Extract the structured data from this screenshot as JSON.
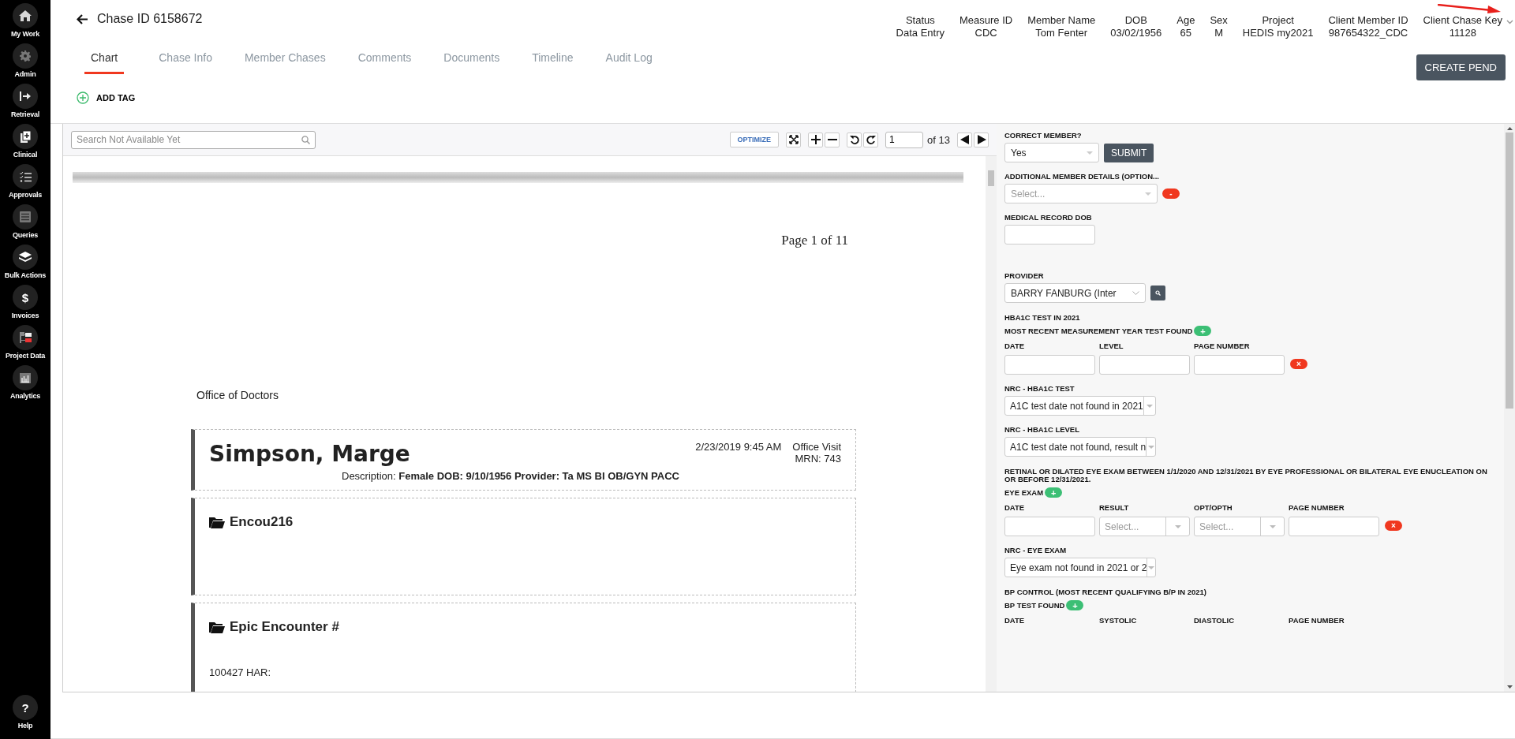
{
  "sidebar": {
    "items": [
      {
        "label": "My Work"
      },
      {
        "label": "Admin"
      },
      {
        "label": "Retrieval"
      },
      {
        "label": "Clinical"
      },
      {
        "label": "Approvals"
      },
      {
        "label": "Queries"
      },
      {
        "label": "Bulk Actions"
      },
      {
        "label": "Invoices",
        "glyph": "$"
      },
      {
        "label": "Project Data"
      },
      {
        "label": "Analytics"
      }
    ],
    "help": {
      "label": "Help",
      "glyph": "?"
    }
  },
  "header": {
    "title": "Chase ID 6158672",
    "info": [
      {
        "label": "Status",
        "value": "Data Entry"
      },
      {
        "label": "Measure ID",
        "value": "CDC"
      },
      {
        "label": "Member Name",
        "value": "Tom Fenter"
      },
      {
        "label": "DOB",
        "value": "03/02/1956"
      },
      {
        "label": "Age",
        "value": "65"
      },
      {
        "label": "Sex",
        "value": "M"
      },
      {
        "label": "Project",
        "value": "HEDIS my2021"
      },
      {
        "label": "Client Member ID",
        "value": "987654322_CDC"
      },
      {
        "label": "Client Chase Key",
        "value": "11128"
      }
    ],
    "tabs": [
      {
        "label": "Chart",
        "selected": true
      },
      {
        "label": "Chase Info",
        "selected": false
      },
      {
        "label": "Member Chases",
        "selected": false
      },
      {
        "label": "Comments",
        "selected": false
      },
      {
        "label": "Documents",
        "selected": false
      },
      {
        "label": "Timeline",
        "selected": false
      },
      {
        "label": "Audit Log",
        "selected": false
      }
    ],
    "create_button": "CREATE PEND",
    "add_tag": "ADD TAG"
  },
  "viewer": {
    "search_placeholder": "Search Not Available Yet",
    "optimize": "OPTIMIZE",
    "page": "1",
    "page_total": "of 13",
    "document": {
      "page_label": "Page 1 of 11",
      "office": "Office of Doctors",
      "patient": "Simpson, Marge",
      "visit_datetime": "2/23/2019 9:45 AM",
      "visit_type": "Office Visit",
      "mrn": "MRN: 743",
      "description": "Description: **Female DOB: 9/10/1956  Provider: Ta MS BI OB/GYN PACC**",
      "sections": [
        {
          "title": "Encou216"
        },
        {
          "title": "Epic Encounter #",
          "body": "100427 HAR:"
        }
      ]
    }
  },
  "form": {
    "items": [
      {
        "kind": "select_button",
        "label": "CORRECT MEMBER?",
        "value": "Yes",
        "button": "SUBMIT"
      },
      {
        "kind": "select_remove",
        "label": "ADDITIONAL MEMBER DETAILS (OPTION...",
        "placeholder": "Select...",
        "remove": "-"
      },
      {
        "kind": "input",
        "label": "MEDICAL RECORD DOB"
      },
      {
        "kind": "select_search",
        "label": "PROVIDER",
        "value": "BARRY FANBURG (Inter"
      },
      {
        "kind": "heading",
        "label": "HBA1C TEST IN 2021"
      },
      {
        "kind": "grid",
        "label": "MOST RECENT MEASUREMENT YEAR TEST FOUND",
        "add": "+",
        "remove": "×",
        "columns": [
          {
            "label": "DATE",
            "kind": "input"
          },
          {
            "label": "LEVEL",
            "kind": "input"
          },
          {
            "label": "PAGE NUMBER",
            "kind": "input"
          }
        ]
      },
      {
        "kind": "combo",
        "label": "NRC - HBA1C TEST",
        "value": "A1C test date not found in 2021"
      },
      {
        "kind": "combo",
        "label": "NRC - HBA1C LEVEL",
        "value": "A1C test date not found, result n"
      },
      {
        "kind": "heading",
        "label": "RETINAL OR DILATED EYE EXAM BETWEEN 1/1/2020 AND 12/31/2021 BY EYE PROFESSIONAL OR BILATERAL EYE ENUCLEATION ON OR BEFORE 12/31/2021."
      },
      {
        "kind": "grid",
        "label": "EYE EXAM",
        "add": "+",
        "remove": "×",
        "columns": [
          {
            "label": "DATE",
            "kind": "input"
          },
          {
            "label": "RESULT",
            "kind": "select",
            "placeholder": "Select..."
          },
          {
            "label": "OPT/OPTH",
            "kind": "select",
            "placeholder": "Select..."
          },
          {
            "label": "PAGE NUMBER",
            "kind": "input"
          }
        ]
      },
      {
        "kind": "combo",
        "label": "NRC - EYE EXAM",
        "value": "Eye exam not found in 2021 or 2"
      },
      {
        "kind": "heading",
        "label": "BP CONTROL (MOST RECENT QUALIFYING B/P IN 2021)"
      },
      {
        "kind": "grid",
        "label": "BP TEST FOUND",
        "add": "+",
        "columns": [
          {
            "label": "DATE"
          },
          {
            "label": "SYSTOLIC"
          },
          {
            "label": "DIASTOLIC"
          },
          {
            "label": "PAGE NUMBER"
          }
        ]
      }
    ]
  }
}
